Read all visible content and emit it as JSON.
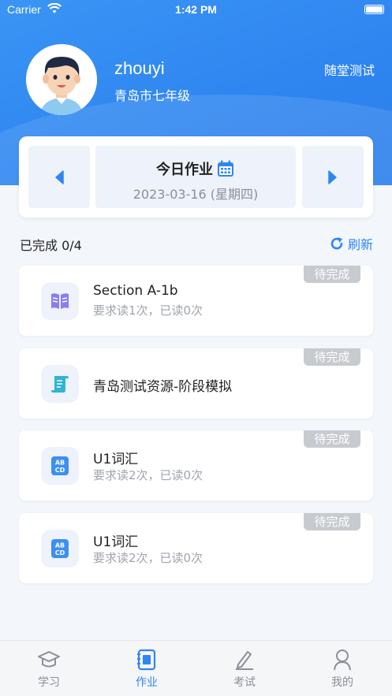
{
  "status_bar": {
    "carrier": "Carrier",
    "time": "1:42 PM"
  },
  "profile": {
    "username": "zhouyi",
    "grade": "青岛市七年级",
    "class_test_label": "随堂测试"
  },
  "date_card": {
    "title": "今日作业",
    "date": "2023-03-16 (星期四)"
  },
  "progress": {
    "text": "已完成 0/4",
    "refresh_label": "刷新"
  },
  "tasks": [
    {
      "title": "Section A-1b",
      "subtitle": "要求读1次，已读0次",
      "badge": "待完成",
      "icon": "book-icon"
    },
    {
      "title": "青岛测试资源-阶段模拟",
      "subtitle": "",
      "badge": "待完成",
      "icon": "scroll-icon"
    },
    {
      "title": "U1词汇",
      "subtitle": "要求读2次，已读0次",
      "badge": "待完成",
      "icon": "abcd-icon"
    },
    {
      "title": "U1词汇",
      "subtitle": "要求读2次，已读0次",
      "badge": "待完成",
      "icon": "abcd-icon"
    }
  ],
  "tabs": [
    {
      "label": "学习",
      "icon": "graduation-cap-icon",
      "active": false
    },
    {
      "label": "作业",
      "icon": "homework-icon",
      "active": true
    },
    {
      "label": "考试",
      "icon": "pencil-icon",
      "active": false
    },
    {
      "label": "我的",
      "icon": "person-icon",
      "active": false
    }
  ],
  "colors": {
    "primary": "#2f86f0",
    "badge": "#c7cacf",
    "background": "#f3f6fb"
  }
}
